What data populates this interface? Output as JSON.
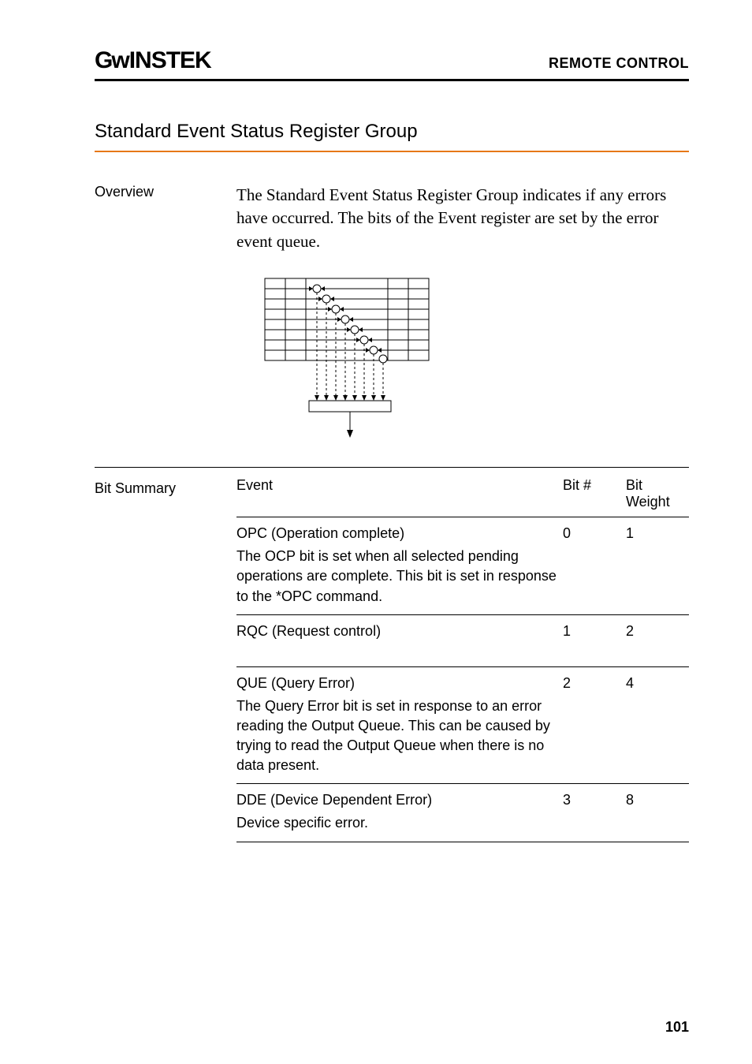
{
  "header": {
    "logo_prefix": "G",
    "logo_u": "ᴡ",
    "logo_rest": "INSTEK",
    "right": "REMOTE CONTROL"
  },
  "section_title": "Standard Event Status Register Group",
  "overview": {
    "label": "Overview",
    "text": "The Standard Event Status Register Group indicates if any errors have occurred. The bits of the Event register are set by the error event queue."
  },
  "bit_summary": {
    "label": "Bit Summary",
    "headers": {
      "event": "Event",
      "bitnum": "Bit #",
      "weight": "Bit Weight"
    },
    "rows": [
      {
        "name": "OPC (Operation complete)",
        "desc": "The OCP bit is set when all selected pending operations are complete. This bit is set in response to the *OPC command.",
        "bitnum": "0",
        "weight": "1"
      },
      {
        "name": "RQC (Request control)",
        "desc": "",
        "bitnum": "1",
        "weight": "2"
      },
      {
        "name": "QUE (Query Error)",
        "desc": "The Query Error bit is set in response to an error reading the Output Queue. This can be caused by trying to read the Output Queue when there is no data present.",
        "bitnum": "2",
        "weight": "4"
      },
      {
        "name": "DDE (Device Dependent Error)",
        "desc": "Device specific error.",
        "bitnum": "3",
        "weight": "8"
      }
    ]
  },
  "page_num": "101"
}
